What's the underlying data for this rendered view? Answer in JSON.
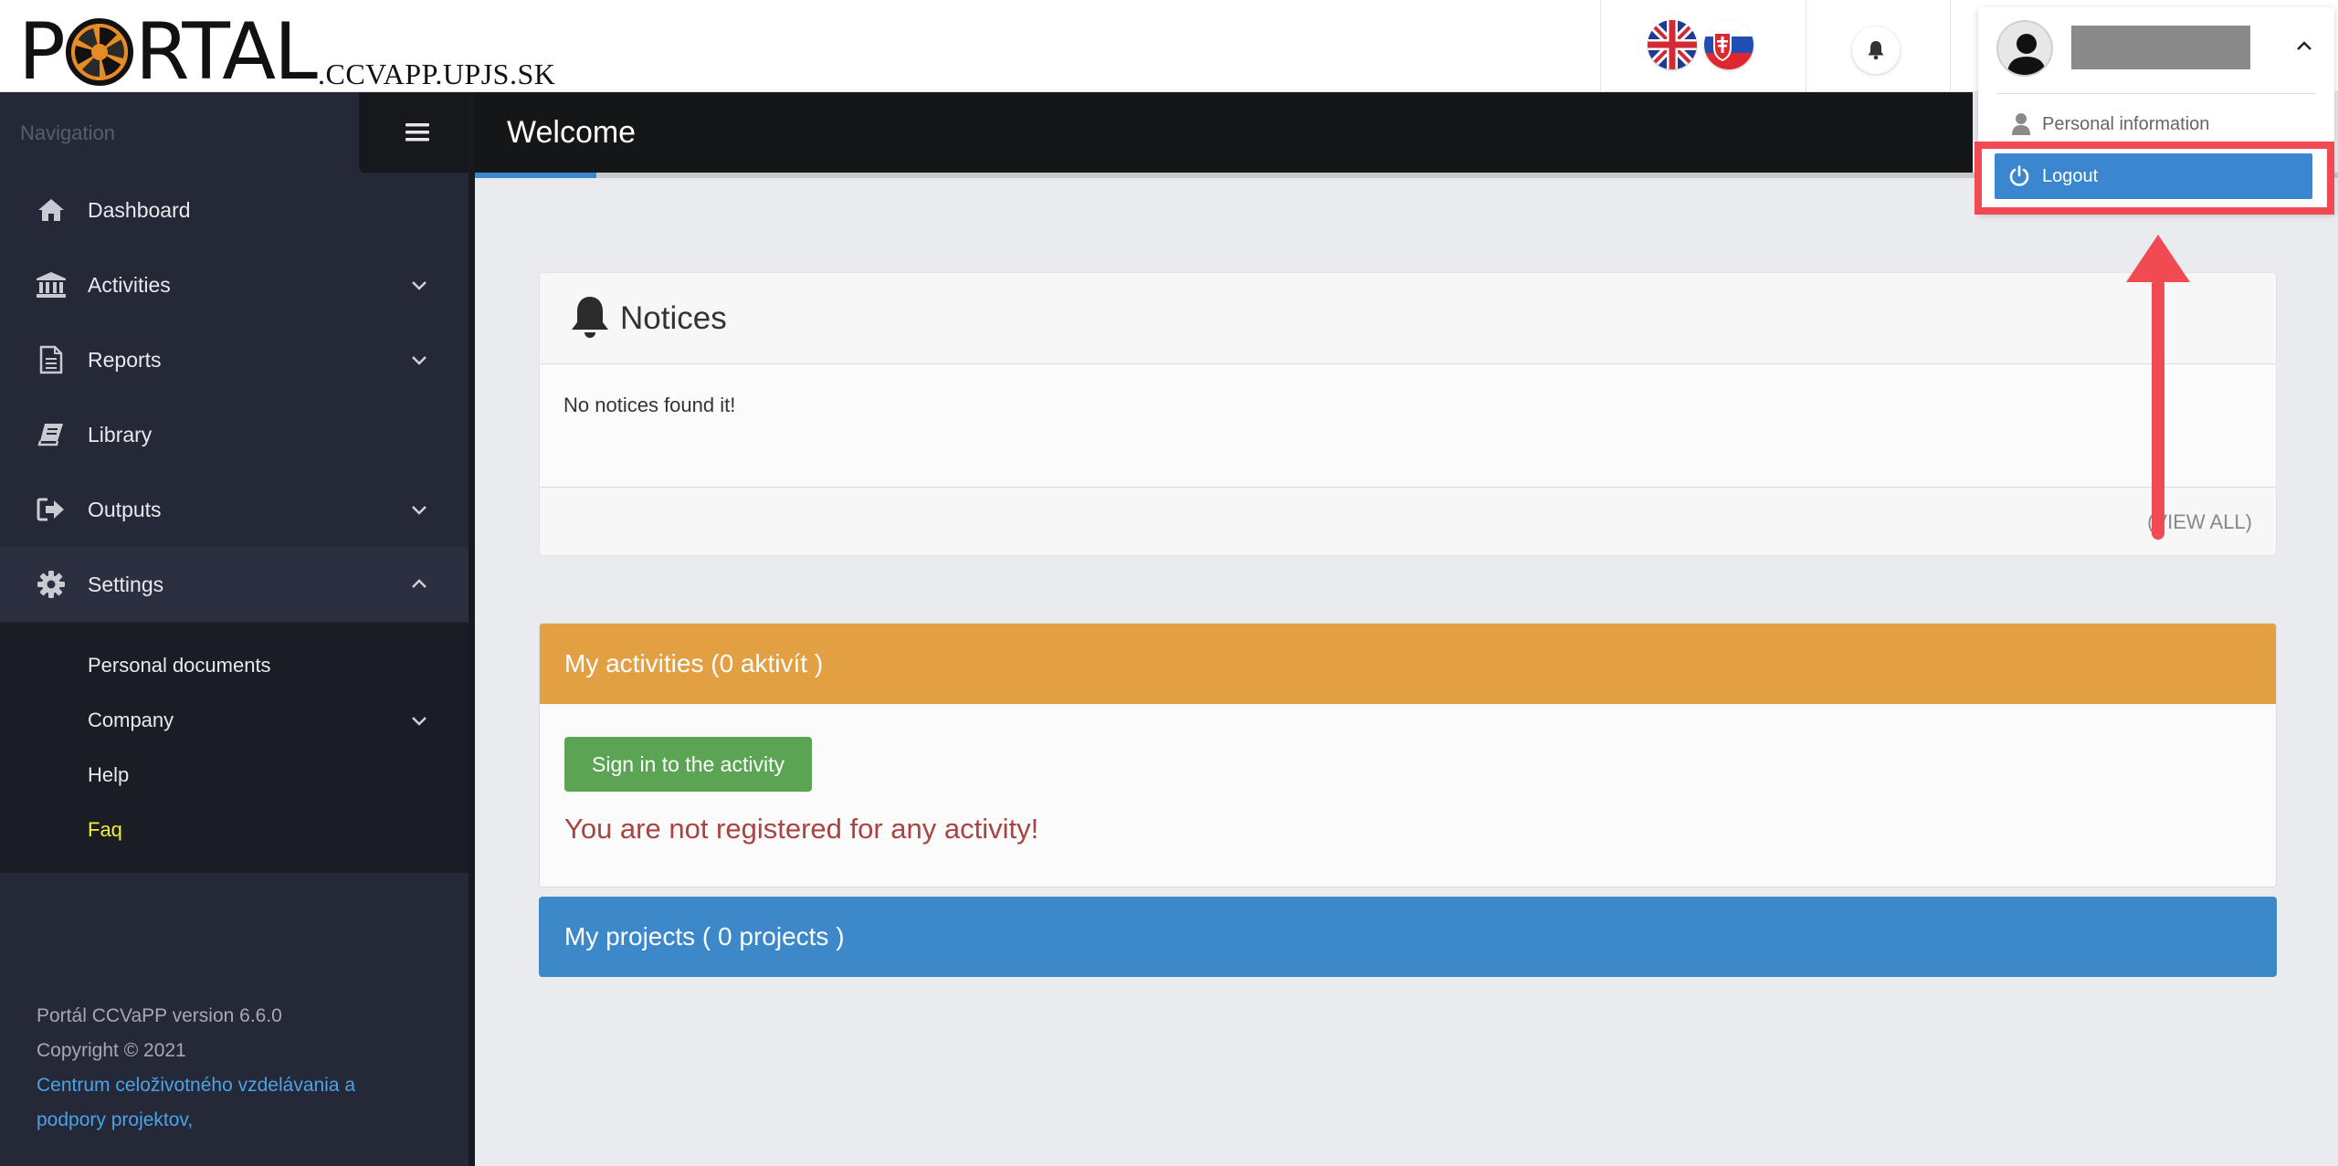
{
  "header": {
    "logo_text_before": "P",
    "logo_text_after": "RTAL",
    "logo_domain": ".CCVAPP.UPJS.SK",
    "languages": [
      "English",
      "Slovak"
    ]
  },
  "sidebar": {
    "nav_title": "Navigation",
    "items": [
      {
        "label": "Dashboard",
        "icon": "home-icon"
      },
      {
        "label": "Activities",
        "icon": "bank-icon"
      },
      {
        "label": "Reports",
        "icon": "document-icon"
      },
      {
        "label": "Library",
        "icon": "book-icon"
      },
      {
        "label": "Outputs",
        "icon": "sign-out-icon"
      },
      {
        "label": "Settings",
        "icon": "gear-icon"
      }
    ],
    "settings_submenu": [
      {
        "label": "Personal documents"
      },
      {
        "label": "Company"
      },
      {
        "label": "Help"
      },
      {
        "label": "Faq"
      }
    ],
    "footer": {
      "version": "Portál CCVaPP version 6.6.0",
      "copyright": "Copyright © 2021",
      "org_line1": "Centrum celoživotného vzdelávania a",
      "org_line2": "podpory projektov,"
    }
  },
  "page": {
    "title": "Welcome",
    "progress": 0.065
  },
  "notices": {
    "title": "Notices",
    "empty_text": "No notices found it!",
    "view_all": "(VIEW ALL)"
  },
  "activities": {
    "title": "My activities (0 aktivít )",
    "signin_button": "Sign in to the activity",
    "not_registered": "You are not registered for any activity!"
  },
  "projects": {
    "title": "My projects ( 0 projects )"
  },
  "user_menu": {
    "personal_information": "Personal information",
    "logout": "Logout"
  },
  "colors": {
    "sidebar_bg": "#252837",
    "activities_header": "#e3a043",
    "projects_header": "#3c88c9",
    "primary_blue": "#3a87cf",
    "annotation_red": "#f24a53",
    "faq_highlight": "#f2ee3b"
  }
}
